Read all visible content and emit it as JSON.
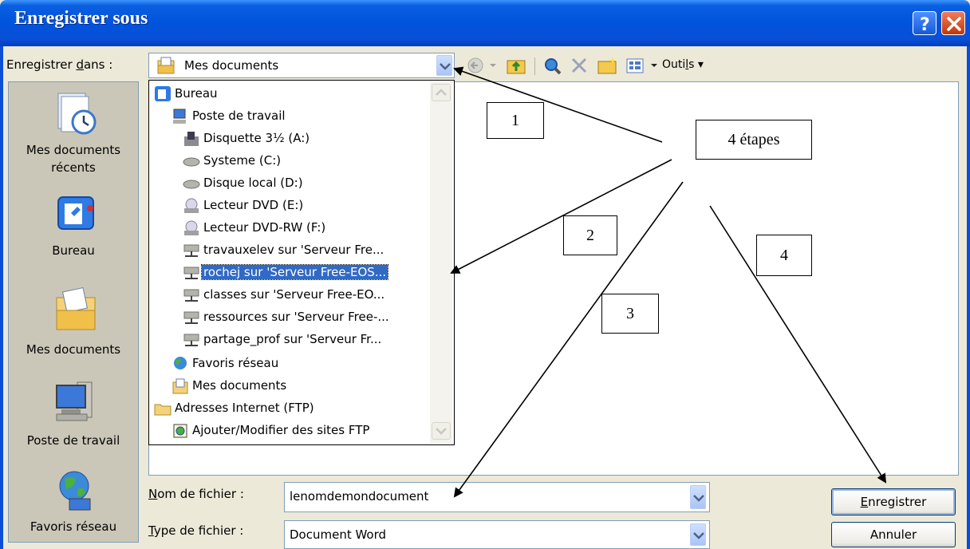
{
  "window": {
    "title": "Enregistrer sous"
  },
  "save_in": {
    "label_pre": "Enregistrer ",
    "label_accel": "d",
    "label_post": "ans :",
    "value": "Mes documents"
  },
  "toolbar": {
    "tools_pre": "Outi",
    "tools_accel": "l",
    "tools_post": "s"
  },
  "places": [
    {
      "name": "Mes documents récents",
      "line1": "Mes documents",
      "line2": "récents",
      "icon": "recent-documents-icon"
    },
    {
      "name": "Bureau",
      "line1": "Bureau",
      "icon": "desktop-icon"
    },
    {
      "name": "Mes documents",
      "line1": "Mes documents",
      "icon": "my-documents-icon"
    },
    {
      "name": "Poste de travail",
      "line1": "Poste de travail",
      "icon": "my-computer-icon"
    },
    {
      "name": "Favoris réseau",
      "line1": "Favoris réseau",
      "icon": "network-places-icon"
    }
  ],
  "dropdown_items": [
    "Bureau",
    "Poste de travail",
    "Disquette 3½ (A:)",
    "Systeme (C:)",
    "Disque local (D:)",
    "Lecteur DVD (E:)",
    "Lecteur DVD-RW (F:)",
    "travauxelev sur 'Serveur Fre...",
    "rochej sur 'Serveur Free-EOS...",
    "classes sur 'Serveur Free-EO...",
    "ressources sur 'Serveur Free-...",
    "partage_prof sur 'Serveur Fr...",
    "Favoris réseau",
    "Mes documents",
    "Adresses Internet (FTP)",
    "Ajouter/Modifier des sites FTP"
  ],
  "filename": {
    "label_accel": "N",
    "label_post": "om de fichier :",
    "value": "lenomdemondocument"
  },
  "filetype": {
    "label_accel": "T",
    "label_post": "ype de fichier :",
    "value": "Document Word"
  },
  "buttons": {
    "save_accel": "E",
    "save_post": "nregistrer",
    "cancel": "Annuler"
  },
  "annotations": {
    "steps": "4 étapes",
    "step1": "1",
    "step2": "2",
    "step3": "3",
    "step4": "4"
  }
}
